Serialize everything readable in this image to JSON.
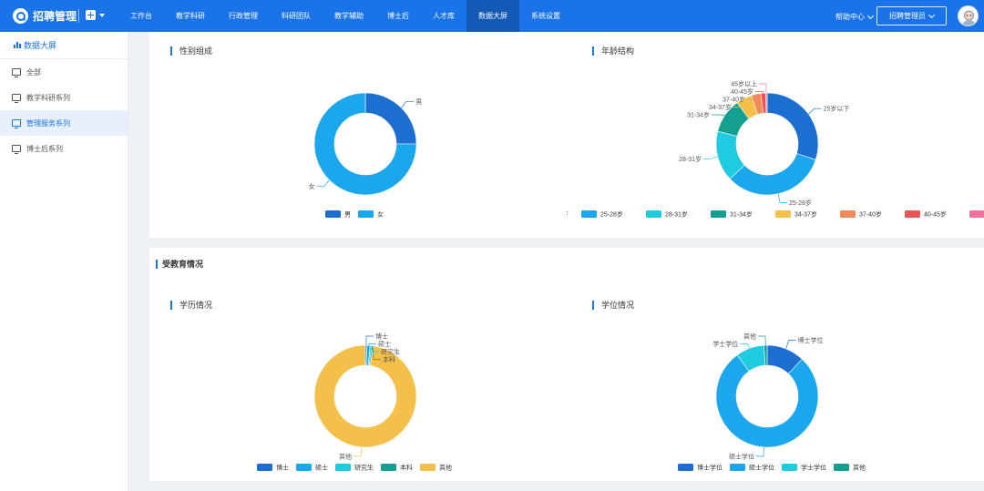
{
  "app": {
    "title": "招聘管理"
  },
  "nav": {
    "items": [
      {
        "label": "工作台",
        "active": false
      },
      {
        "label": "教学科研",
        "active": false
      },
      {
        "label": "行政管理",
        "active": false
      },
      {
        "label": "科研团队",
        "active": false
      },
      {
        "label": "教学辅助",
        "active": false
      },
      {
        "label": "博士后",
        "active": false
      },
      {
        "label": "人才库",
        "active": false
      },
      {
        "label": "数据大屏",
        "active": true
      },
      {
        "label": "系统设置",
        "active": false
      }
    ],
    "help_label": "帮助中心",
    "role_label": "招聘管理员"
  },
  "sidebar": {
    "title": "数据大屏",
    "items": [
      {
        "label": "全部",
        "active": false
      },
      {
        "label": "教学科研系列",
        "active": false
      },
      {
        "label": "管理服务系列",
        "active": true
      },
      {
        "label": "博士后系列",
        "active": false
      }
    ]
  },
  "sections": {
    "gender_title": "性别组成",
    "age_title": "年龄结构",
    "education_title": "受教育情况",
    "edu_bg_title": "学历情况",
    "degree_title": "学位情况"
  },
  "chart_data": [
    {
      "id": "gender",
      "type": "pie",
      "title": "性别组成",
      "categories": [
        "男",
        "女"
      ],
      "values": [
        25,
        75
      ],
      "colors": [
        "#1c6fd1",
        "#1aa7ee"
      ],
      "legend_position": "bottom"
    },
    {
      "id": "age",
      "type": "pie",
      "title": "年龄结构",
      "categories": [
        "25岁以下",
        "25-28岁",
        "28-31岁",
        "31-34岁",
        "34-37岁",
        "37-40岁",
        "40-45岁",
        "45岁以上"
      ],
      "values": [
        30,
        33,
        16,
        11,
        5,
        3,
        1.5,
        0.5
      ],
      "colors": [
        "#1c6fd1",
        "#1aa7ee",
        "#1ecbe1",
        "#13a090",
        "#f5c04a",
        "#f28a5a",
        "#e85454",
        "#f0729b"
      ],
      "legend_position": "bottom"
    },
    {
      "id": "education",
      "type": "pie",
      "title": "学历情况",
      "categories": [
        "博士",
        "硕士",
        "研究生",
        "本科",
        "其他"
      ],
      "values": [
        0.5,
        1,
        0.5,
        0.5,
        97.5
      ],
      "colors": [
        "#1c6fd1",
        "#1aa7ee",
        "#1ecbe1",
        "#13a090",
        "#f5c04a"
      ],
      "legend_position": "bottom"
    },
    {
      "id": "degree",
      "type": "pie",
      "title": "学位情况",
      "categories": [
        "博士学位",
        "硕士学位",
        "学士学位",
        "其他"
      ],
      "values": [
        12,
        78,
        9,
        1
      ],
      "colors": [
        "#1c6fd1",
        "#1aa7ee",
        "#1ecbe1",
        "#13a090"
      ],
      "legend_position": "bottom"
    }
  ]
}
